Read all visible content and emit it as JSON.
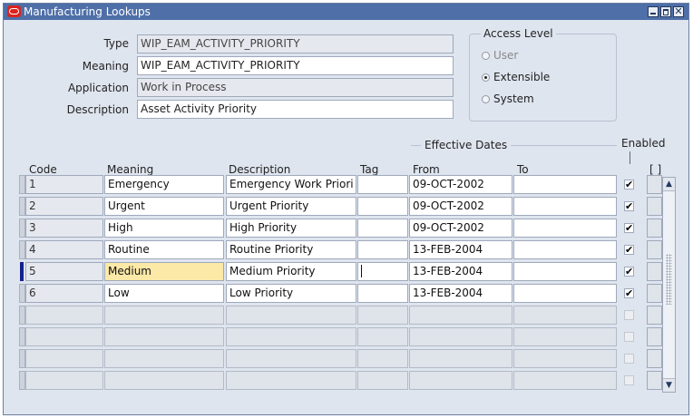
{
  "window": {
    "title": "Manufacturing Lookups",
    "close_glyph": "✕"
  },
  "header": {
    "type_label": "Type",
    "type_value": "WIP_EAM_ACTIVITY_PRIORITY",
    "meaning_label": "Meaning",
    "meaning_value": "WIP_EAM_ACTIVITY_PRIORITY",
    "application_label": "Application",
    "application_value": "Work in Process",
    "description_label": "Description",
    "description_value": "Asset Activity Priority"
  },
  "access_level": {
    "title": "Access Level",
    "options": [
      {
        "label": "User",
        "selected": false,
        "enabled": false
      },
      {
        "label": "Extensible",
        "selected": true,
        "enabled": true
      },
      {
        "label": "System",
        "selected": false,
        "enabled": true
      }
    ]
  },
  "table": {
    "effective_dates_label": "Effective Dates",
    "enabled_label": "Enabled",
    "dff_label": "[ ]",
    "columns": [
      "Code",
      "Meaning",
      "Description",
      "Tag",
      "From",
      "To"
    ],
    "rows": [
      {
        "code": "1",
        "meaning": "Emergency",
        "description": "Emergency Work Priori",
        "tag": "",
        "from": "09-OCT-2002",
        "to": "",
        "enabled": true
      },
      {
        "code": "2",
        "meaning": "Urgent",
        "description": "Urgent Priority",
        "tag": "",
        "from": "09-OCT-2002",
        "to": "",
        "enabled": true
      },
      {
        "code": "3",
        "meaning": "High",
        "description": "High Priority",
        "tag": "",
        "from": "09-OCT-2002",
        "to": "",
        "enabled": true
      },
      {
        "code": "4",
        "meaning": "Routine",
        "description": "Routine Priority",
        "tag": "",
        "from": "13-FEB-2004",
        "to": "",
        "enabled": true
      },
      {
        "code": "5",
        "meaning": "Medium",
        "description": "Medium Priority",
        "tag": "",
        "from": "13-FEB-2004",
        "to": "",
        "enabled": true
      },
      {
        "code": "6",
        "meaning": "Low",
        "description": "Low Priority",
        "tag": "",
        "from": "13-FEB-2004",
        "to": "",
        "enabled": true
      }
    ],
    "empty_rows": 4,
    "current_row": 5,
    "check_glyph": "✔"
  },
  "colors": {
    "titlebar": "#4e6fa8",
    "window_bg": "#dfe5ef",
    "highlight_cell": "#fce9a8",
    "current_row_marker": "#14238c",
    "oracle_red": "#d9241f"
  },
  "icons": {
    "title_icon": "oracle-logo-icon",
    "minimize": "minimize-icon",
    "maximize": "maximize-icon",
    "close": "close-icon",
    "scroll_up": "scroll-up-arrow-icon",
    "scroll_down": "scroll-down-arrow-icon"
  }
}
